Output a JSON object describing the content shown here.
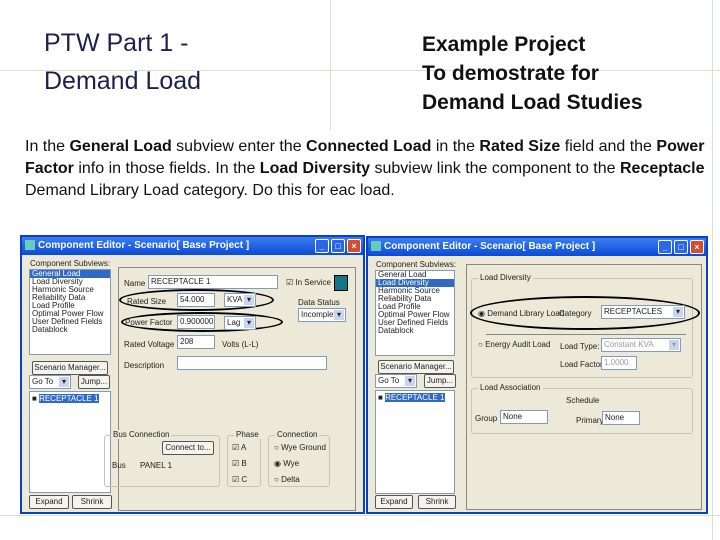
{
  "slide": {
    "title_line1": "PTW Part 1 -",
    "title_line2": "Demand Load",
    "subtitle_line1": "Example Project",
    "subtitle_line2": "To demostrate for",
    "subtitle_line3": "Demand Load Studies"
  },
  "instructions": {
    "p1": "In the ",
    "b1": "General Load",
    "p2": " subview enter the ",
    "b2": "Connected Load",
    "p3": " in the ",
    "b3": "Rated Size",
    "p4": " field and the ",
    "b4": "Power Factor",
    "p5": " info in those fields. In the ",
    "b5": "Load Diversity",
    "p6": " subview link the component to the ",
    "b6": "Receptacle",
    "p7": " Demand Library Load category. Do this for eac load."
  },
  "left_window": {
    "title": "Component Editor - Scenario[ Base Project ]",
    "subviews_label": "Component Subviews:",
    "subviews": [
      "General Load",
      "Load Diversity",
      "Harmonic Source",
      "Reliability Data",
      "Load Profile",
      "Optimal Power Flow",
      "User Defined Fields",
      "Datablock"
    ],
    "scenario_manager": "Scenario Manager...",
    "goto": "Go To",
    "jump": "Jump...",
    "tree_item": "RECEPTACLE 1",
    "expand": "Expand",
    "shrink": "Shrink",
    "name_label": "Name",
    "name_value": "RECEPTACLE 1",
    "in_service": "In Service",
    "rated_size_label": "Rated Size",
    "rated_size_value": "54.000",
    "rated_size_unit": "KVA",
    "data_status_label": "Data Status",
    "data_status_value": "Incomplete",
    "power_factor_label": "Power Factor",
    "power_factor_value": "0.900000",
    "power_factor_type": "Lag",
    "rated_voltage_label": "Rated Voltage",
    "rated_voltage_value": "208",
    "rated_voltage_unit": "Volts (L-L)",
    "description_label": "Description",
    "bus_connection": "Bus Connection",
    "connect_to": "Connect to...",
    "bus_label": "Bus",
    "bus_value": "PANEL 1",
    "phase": "Phase",
    "phases": [
      "A",
      "B",
      "C"
    ],
    "connection": "Connection",
    "connections": [
      "Wye Ground",
      "Wye",
      "Delta"
    ]
  },
  "right_window": {
    "title": "Component Editor - Scenario[ Base Project ]",
    "subviews_label": "Component Subviews:",
    "subviews": [
      "General Load",
      "Load Diversity",
      "Harmonic Source",
      "Reliability Data",
      "Load Profile",
      "Optimal Power Flow",
      "User Defined Fields",
      "Datablock"
    ],
    "scenario_manager": "Scenario Manager...",
    "goto": "Go To",
    "jump": "Jump...",
    "tree_item": "RECEPTACLE 1",
    "expand": "Expand",
    "shrink": "Shrink",
    "load_diversity": "Load Diversity",
    "demand_option": "Demand Library Load",
    "category_label": "Category",
    "category_value": "RECEPTACLES",
    "energy_option": "Energy Audit Load",
    "load_type_label": "Load Type:",
    "load_type_value": "Constant KVA",
    "load_factor_label": "Load Factor",
    "load_factor_value": "1.0000",
    "load_association": "Load Association",
    "schedule": "Schedule",
    "group_label": "Group",
    "group_value": "None",
    "primary_label": "Primary",
    "primary_value": "None"
  }
}
